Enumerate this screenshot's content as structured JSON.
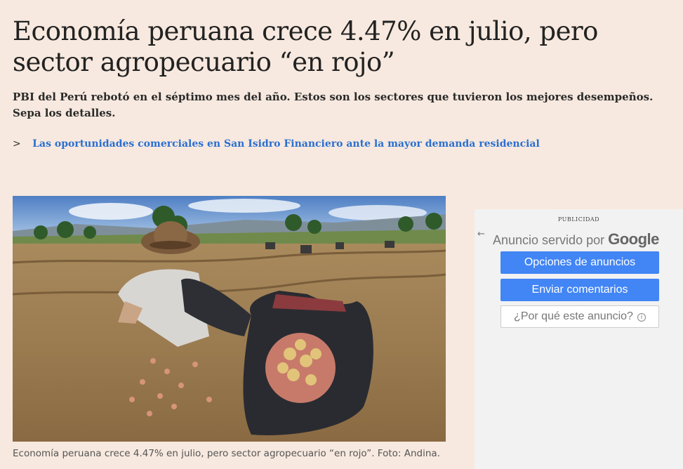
{
  "article": {
    "headline": "Economía peruana crece 4.47% en julio, pero sector agropecuario “en rojo”",
    "lead": "PBI del Perú rebotó en el séptimo mes del año. Estos son los sectores que tuvieron los mejores desempeños. Sepa los detalles.",
    "related_chevron": ">",
    "related_link": "Las oportunidades comerciales en San Isidro Financiero ante la mayor demanda residencial",
    "caption": "Economía peruana crece 4.47% en julio, pero sector agropecuario “en rojo”. Foto: Andina."
  },
  "ad": {
    "label": "PUBLICIDAD",
    "back_icon": "←",
    "served_by": "Anuncio servido por",
    "google": "Google",
    "options_button": "Opciones de anuncios",
    "feedback_button": "Enviar comentarios",
    "why_button": "¿Por qué este anuncio?",
    "info_icon": "i",
    "button_color": "#4285f4"
  },
  "colors": {
    "page_background": "#f7e9df",
    "link": "#2a6fd1"
  }
}
